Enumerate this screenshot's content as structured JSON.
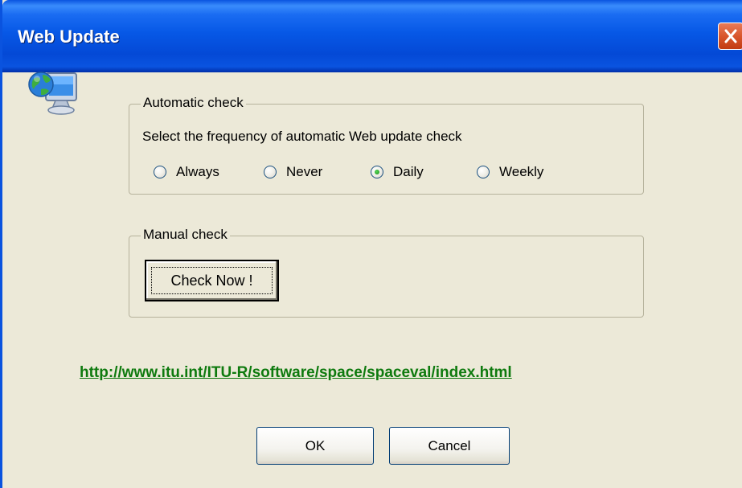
{
  "window": {
    "title": "Web Update",
    "close_icon": "close-icon"
  },
  "app_icon": "globe-computer-icon",
  "automatic_check": {
    "legend": "Automatic check",
    "description": "Select the frequency of automatic Web update check",
    "options": [
      {
        "label": "Always",
        "checked": false
      },
      {
        "label": "Never",
        "checked": false
      },
      {
        "label": "Daily",
        "checked": true
      },
      {
        "label": "Weekly",
        "checked": false
      }
    ]
  },
  "manual_check": {
    "legend": "Manual check",
    "button_label": "Check Now !"
  },
  "link": {
    "text": "http://www.itu.int/ITU-R/software/space/spaceval/index.html",
    "color": "#0e7a0e"
  },
  "buttons": {
    "ok": "OK",
    "cancel": "Cancel"
  },
  "colors": {
    "titlebar": "#0a54e0",
    "background": "#ece9d8",
    "radio_selected": "#21a121"
  }
}
